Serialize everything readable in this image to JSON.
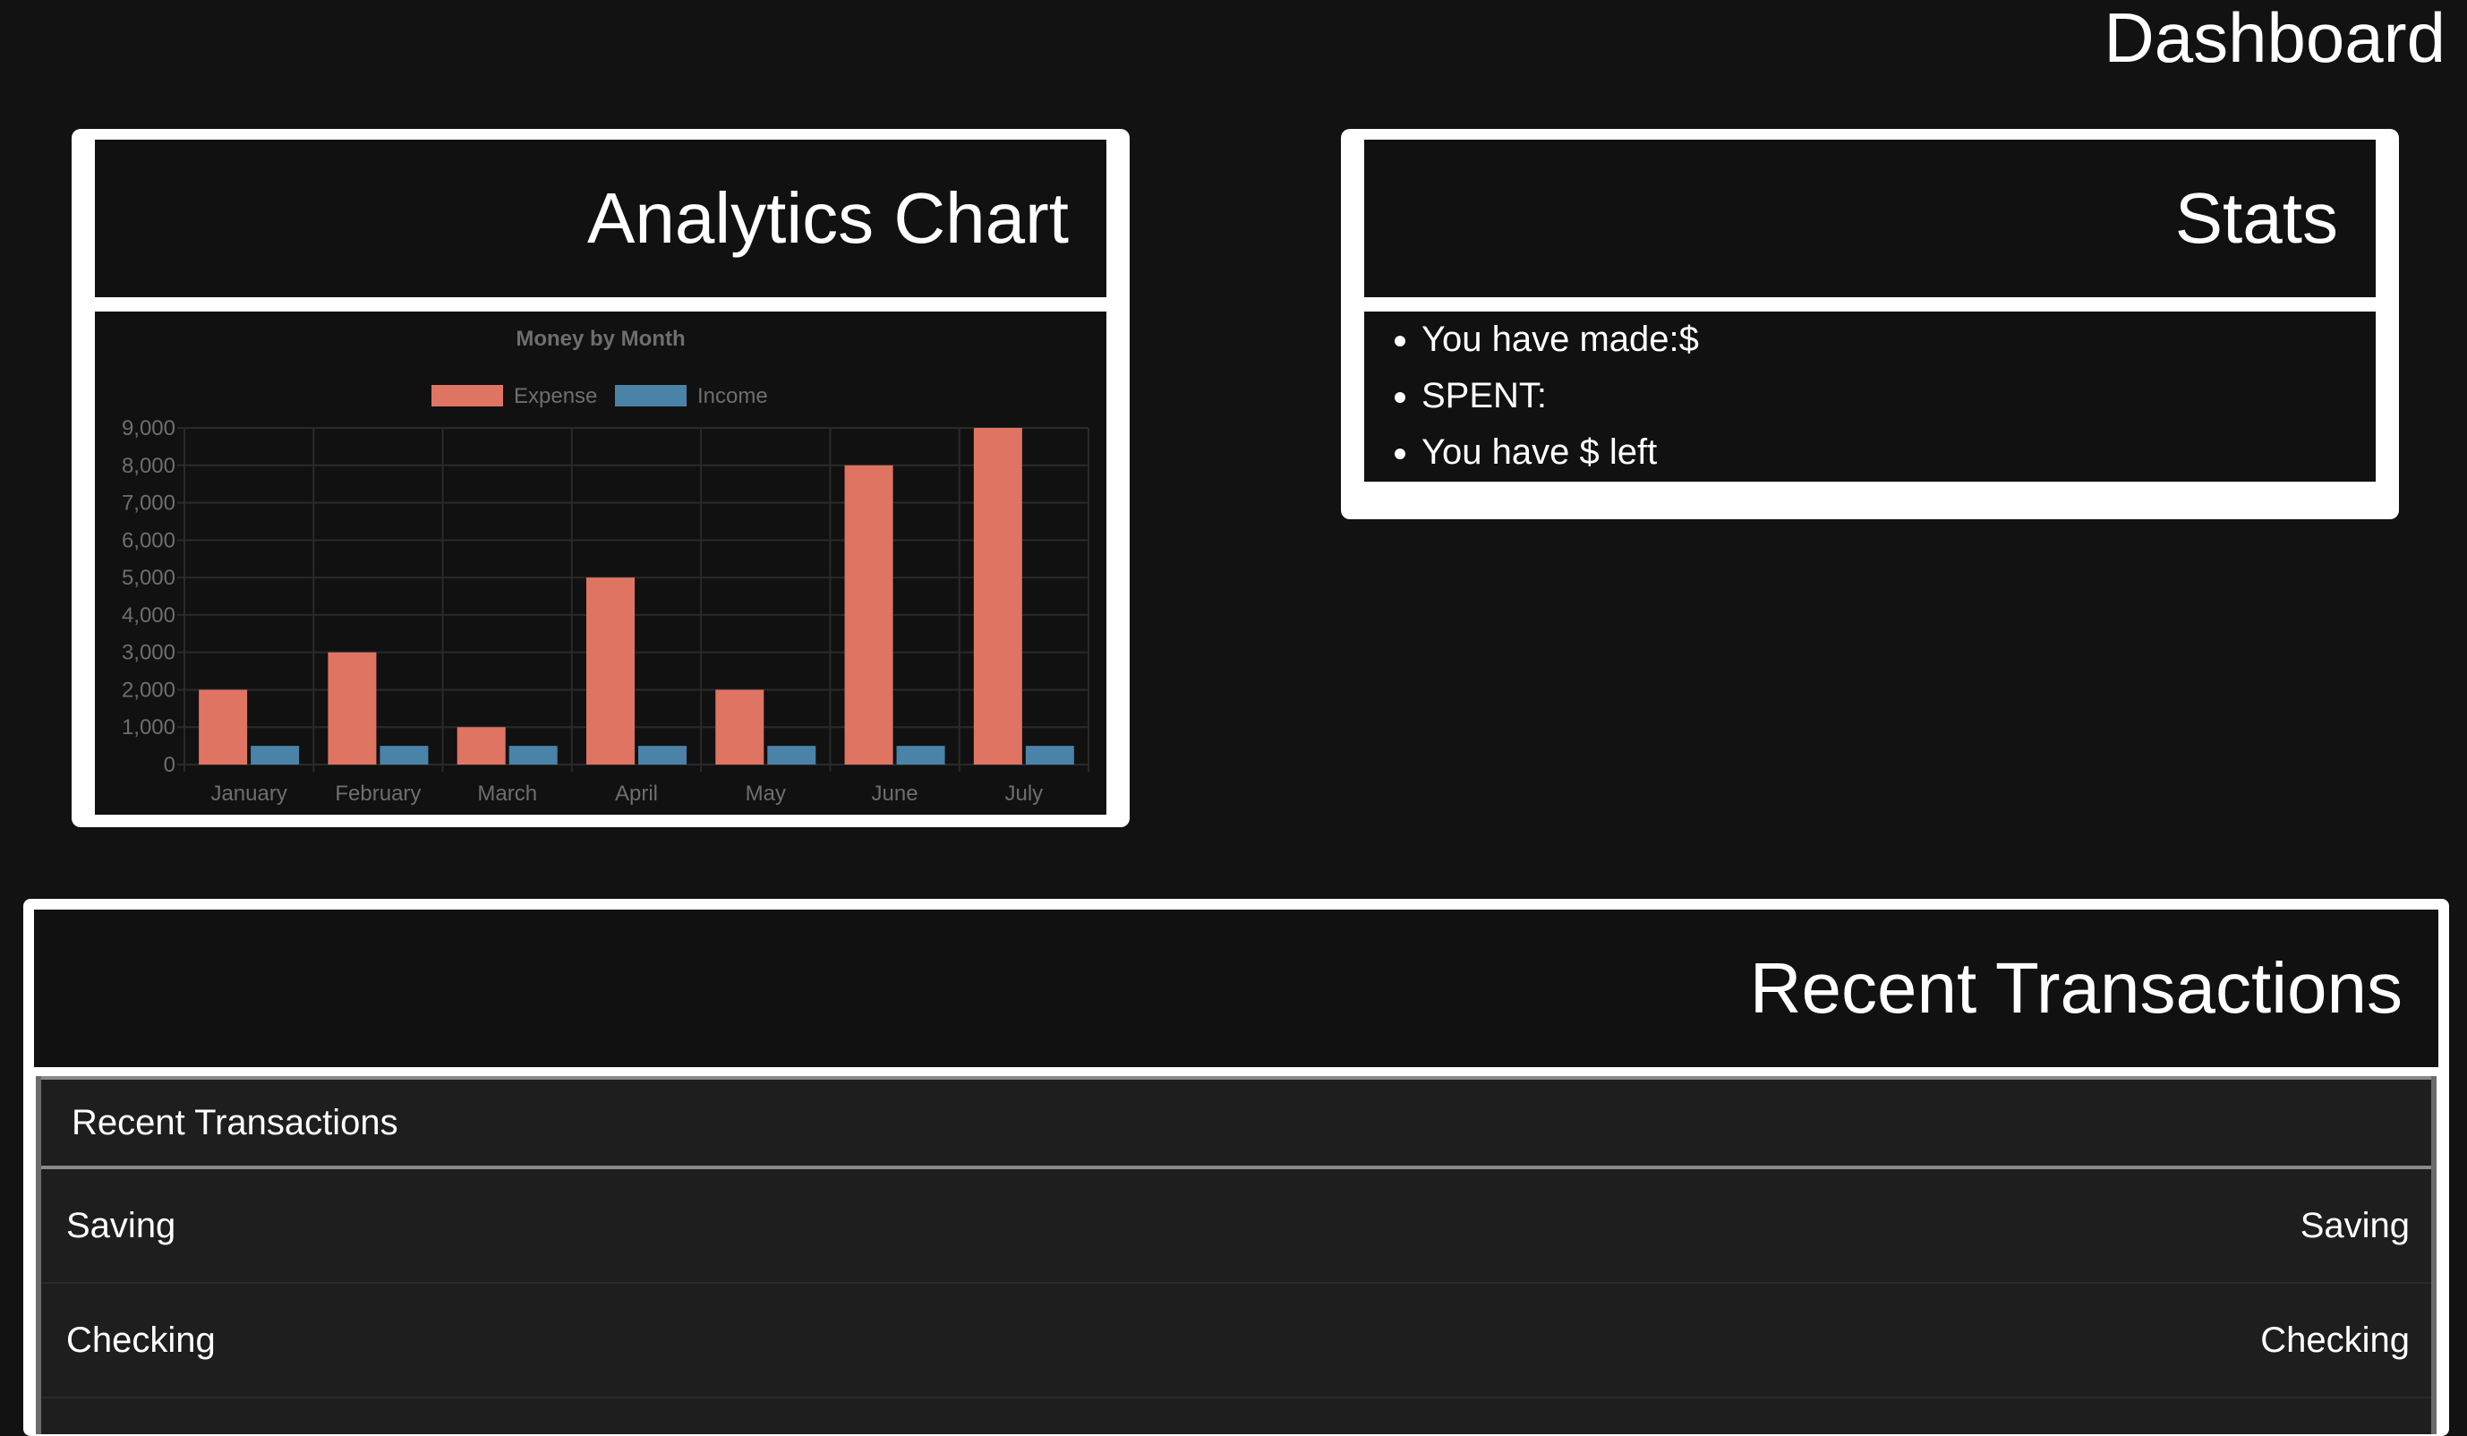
{
  "page": {
    "title": "Dashboard"
  },
  "analytics": {
    "title": "Analytics Chart"
  },
  "stats": {
    "title": "Stats",
    "items": [
      "You have made:$",
      "SPENT:",
      "You have $ left"
    ]
  },
  "transactions": {
    "title": "Recent Transactions",
    "panel_header": "Recent Transactions",
    "rows": [
      {
        "left": "Saving",
        "right": "Saving"
      },
      {
        "left": "Checking",
        "right": "Checking"
      }
    ]
  },
  "colors": {
    "expense": "#e07462",
    "income": "#4a82a8",
    "background": "#121212"
  },
  "chart_data": {
    "type": "bar",
    "title": "Money by Month",
    "categories": [
      "January",
      "February",
      "March",
      "April",
      "May",
      "June",
      "July"
    ],
    "series": [
      {
        "name": "Expense",
        "values": [
          2000,
          3000,
          1000,
          5000,
          2000,
          8000,
          9000
        ],
        "color": "#e07462"
      },
      {
        "name": "Income",
        "values": [
          500,
          500,
          500,
          500,
          500,
          500,
          500
        ],
        "color": "#4a82a8"
      }
    ],
    "yticks": [
      "0",
      "1,000",
      "2,000",
      "3,000",
      "4,000",
      "5,000",
      "6,000",
      "7,000",
      "8,000",
      "9,000"
    ],
    "ylim": [
      0,
      9000
    ],
    "legend": "top",
    "grid": true
  }
}
